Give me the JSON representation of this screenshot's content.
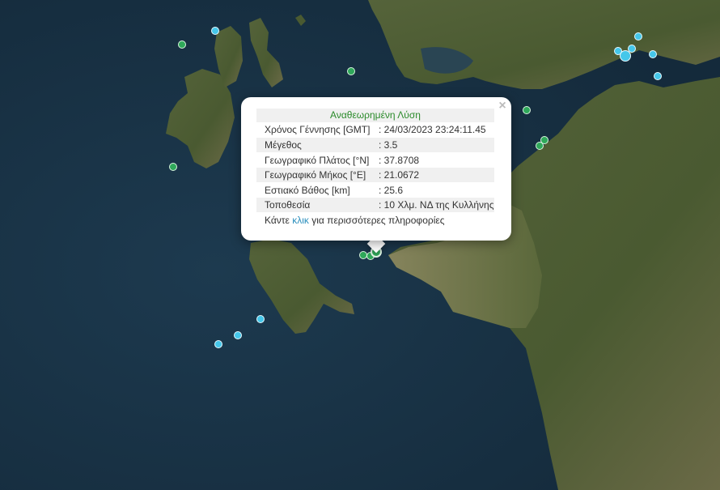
{
  "popup": {
    "title": "Αναθεωρημένη Λύση",
    "close": "×",
    "rows": [
      {
        "label": "Χρόνος Γέννησης [GMT]",
        "value": ": 24/03/2023 23:24:11.45"
      },
      {
        "label": "Μέγεθος",
        "value": ": 3.5"
      },
      {
        "label": "Γεωγραφικό Πλάτος [°N]",
        "value": ": 37.8708"
      },
      {
        "label": "Γεωγραφικό Μήκος [°E]",
        "value": ": 21.0672"
      },
      {
        "label": "Εστιακό Βάθος [km]",
        "value": ": 25.6"
      },
      {
        "label": "Τοποθεσία",
        "value": ": 10 Χλμ. ΝΔ της Κυλλήνης"
      }
    ],
    "more_prefix": "Κάντε ",
    "more_link": "κλικ",
    "more_suffix": " για περισσότερες πληροφορίες"
  },
  "colors": {
    "sea": "#1b3346",
    "land": "#4d5c33",
    "marker_green": "#2fa85a",
    "marker_cyan": "#45c7ea",
    "title_green": "#2a8a2a",
    "link": "#2b8fbd"
  }
}
